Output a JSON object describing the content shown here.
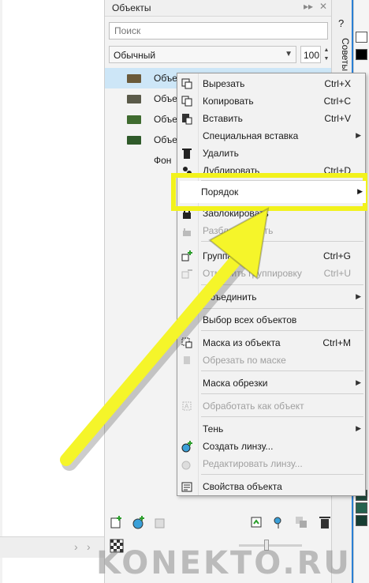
{
  "panel": {
    "title": "Объекты",
    "search_placeholder": "Поиск",
    "blend_mode": "Обычный",
    "opacity": "100",
    "objects": [
      {
        "name": "Объе",
        "selected": true,
        "color": "#6b5a3a"
      },
      {
        "name": "Объе",
        "selected": false,
        "color": "#5a5a4a"
      },
      {
        "name": "Объе",
        "selected": false,
        "color": "#3f6b2f"
      },
      {
        "name": "Объе",
        "selected": false,
        "color": "#2f5a2a"
      },
      {
        "name": "Фон",
        "selected": false,
        "color": ""
      }
    ]
  },
  "right_tab": {
    "label": "Советы",
    "help": "?"
  },
  "context_menu": {
    "items": [
      {
        "label": "Вырезать",
        "shortcut": "Ctrl+X"
      },
      {
        "label": "Копировать",
        "shortcut": "Ctrl+C"
      },
      {
        "label": "Вставить",
        "shortcut": "Ctrl+V"
      },
      {
        "label": "Специальная вставка",
        "shortcut": ""
      },
      {
        "label": "Удалить",
        "shortcut": ""
      },
      {
        "label": "Дублировать",
        "shortcut": "Ctrl+D"
      },
      {
        "label": "Порядок",
        "shortcut": ""
      },
      {
        "label": "Заблокировать",
        "shortcut": ""
      },
      {
        "label": "Разблокировать",
        "shortcut": ""
      },
      {
        "label": "Группа",
        "shortcut": "Ctrl+G"
      },
      {
        "label": "Отменить группировку",
        "shortcut": "Ctrl+U"
      },
      {
        "label": "Объединить",
        "shortcut": ""
      },
      {
        "label": "Выбор всех объектов",
        "shortcut": ""
      },
      {
        "label": "Маска из объекта",
        "shortcut": "Ctrl+M"
      },
      {
        "label": "Обрезать по маске",
        "shortcut": ""
      },
      {
        "label": "Маска обрезки",
        "shortcut": ""
      },
      {
        "label": "Обработать как объект",
        "shortcut": ""
      },
      {
        "label": "Тень",
        "shortcut": ""
      },
      {
        "label": "Создать линзу...",
        "shortcut": ""
      },
      {
        "label": "Редактировать линзу...",
        "shortcut": ""
      },
      {
        "label": "Свойства объекта",
        "shortcut": ""
      }
    ]
  },
  "colors": {
    "highlight": "#f2f21c",
    "selection": "#cde6f7",
    "arrow": "#f5f52a"
  },
  "watermark": "KONEKTO.RU"
}
